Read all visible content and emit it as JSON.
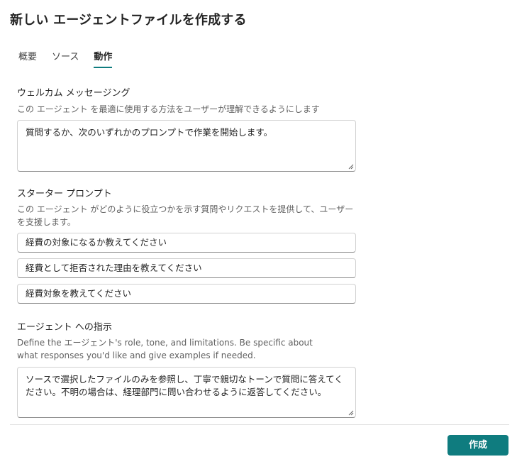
{
  "dialog": {
    "title": "新しい エージェントファイルを作成する"
  },
  "tabs": [
    {
      "label": "概要",
      "active": false
    },
    {
      "label": "ソース",
      "active": false
    },
    {
      "label": "動作",
      "active": true
    }
  ],
  "welcome": {
    "label": "ウェルカム メッセージング",
    "description": "この エージェント を最適に使用する方法をユーザーが理解できるようにします",
    "value": "質問するか、次のいずれかのプロンプトで作業を開始します。"
  },
  "starter": {
    "label": "スターター プロンプト",
    "description": "この エージェント がどのように役立つかを示す質問やリクエストを提供して、ユーザーを支援します。",
    "prompts": [
      "経費の対象になるか教えてください",
      "経費として拒否された理由を教えてください",
      "経費対象を教えてください"
    ]
  },
  "instructions": {
    "label": "エージェント への指示",
    "description": "Define the エージェント's role, tone, and limitations. Be specific about what responses you'd like and give examples if needed.",
    "value": "ソースで選択したファイルのみを参照し、丁寧で親切なトーンで質問に答えてください。不明の場合は、経理部門に問い合わせるように返答してください。"
  },
  "footer": {
    "create_label": "作成"
  },
  "colors": {
    "accent": "#0f7c7f"
  }
}
